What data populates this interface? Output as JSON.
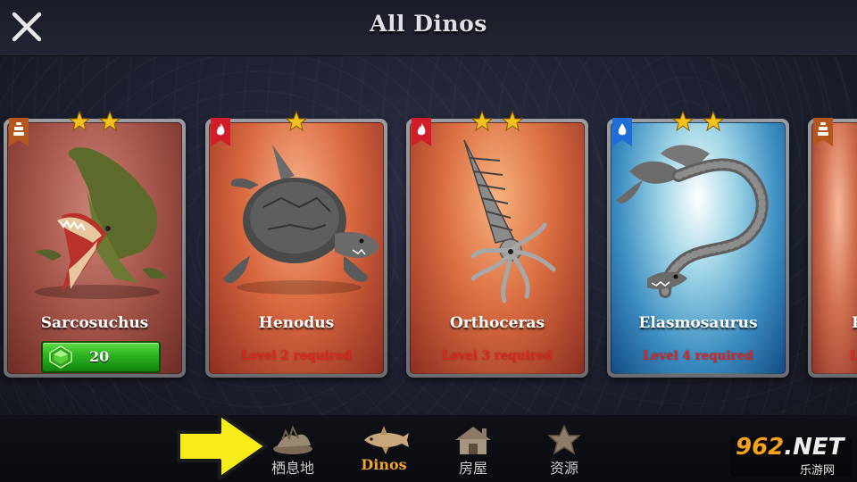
{
  "header": {
    "title": "All Dinos",
    "close_icon": "close-icon"
  },
  "cards": [
    {
      "name": "Sarcosuchus",
      "type": "earth",
      "stars": 2,
      "price": "20",
      "requirement": ""
    },
    {
      "name": "Henodus",
      "type": "fire",
      "stars": 1,
      "price": "",
      "requirement": "Level 2 required"
    },
    {
      "name": "Orthoceras",
      "type": "fire",
      "stars": 2,
      "price": "",
      "requirement": "Level 3 required"
    },
    {
      "name": "Elasmosaurus",
      "type": "water",
      "stars": 2,
      "price": "",
      "requirement": "Level 4 required"
    },
    {
      "name": "E",
      "type": "earth",
      "stars": 0,
      "price": "",
      "requirement": "Le"
    }
  ],
  "tabs": [
    {
      "label": "栖息地",
      "icon": "habitat-icon",
      "active": false
    },
    {
      "label": "Dinos",
      "icon": "dino-icon",
      "active": true
    },
    {
      "label": "房屋",
      "icon": "house-icon",
      "active": false
    },
    {
      "label": "资源",
      "icon": "resource-star-icon",
      "active": false
    }
  ],
  "colors": {
    "earth": "#b5561e",
    "fire": "#d31c2a",
    "water": "#1f6ed8",
    "accent": "#f0a42a",
    "require": "#e0231c"
  },
  "watermark": {
    "brand_digits": "962",
    "brand_suffix": ".NET",
    "site": "乐游网"
  }
}
